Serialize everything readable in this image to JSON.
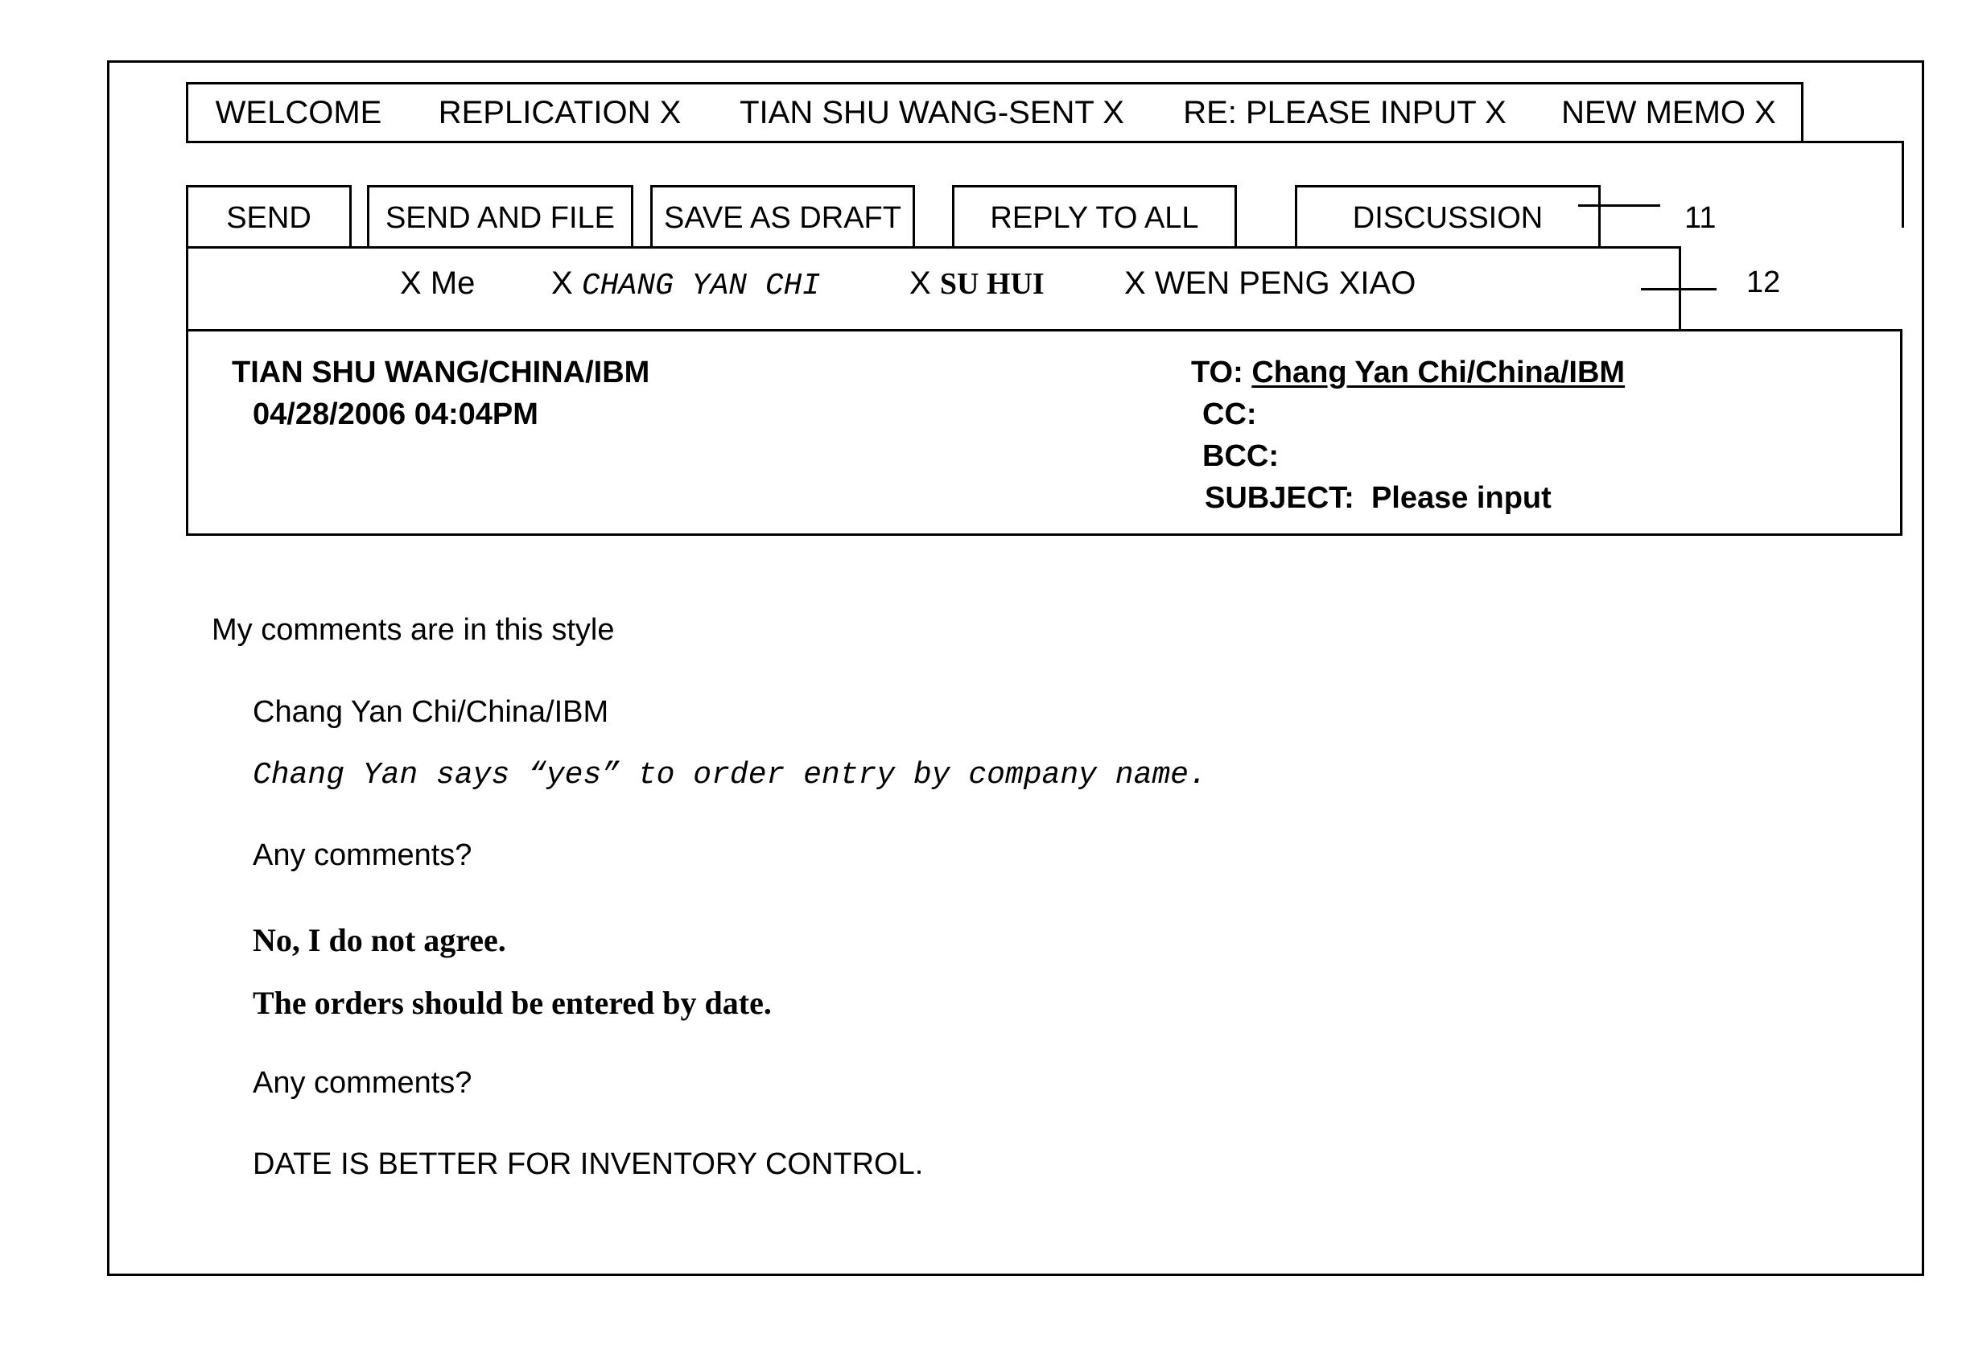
{
  "tabs": [
    {
      "label": "WELCOME"
    },
    {
      "label": "REPLICATION X"
    },
    {
      "label": "TIAN SHU WANG-SENT X"
    },
    {
      "label": "RE: PLEASE INPUT X"
    },
    {
      "label": "NEW MEMO X"
    }
  ],
  "toolbar": {
    "send": "SEND",
    "send_and_file": "SEND AND FILE",
    "save_as_draft": "SAVE AS DRAFT",
    "reply_to_all": "REPLY TO ALL",
    "discussion": "DISCUSSION"
  },
  "recipients": [
    {
      "prefix": "X",
      "name": "Me"
    },
    {
      "prefix": "X",
      "name": "CHANG YAN CHI"
    },
    {
      "prefix": "X",
      "name": "SU HUI"
    },
    {
      "prefix": "X",
      "name": "WEN PENG XIAO"
    }
  ],
  "callouts": {
    "discussion": "11",
    "recipients": "12"
  },
  "header": {
    "from": "TIAN SHU WANG/CHINA/IBM",
    "datetime": "04/28/2006 04:04PM",
    "to_label": "TO:",
    "to_value": "Chang Yan Chi/China/IBM",
    "cc_label": "CC:",
    "bcc_label": "BCC:",
    "subject_label": "SUBJECT:",
    "subject_value": "Please input"
  },
  "body": {
    "intro": "My comments are in this style",
    "author": "Chang Yan Chi/China/IBM",
    "quote": "Chang Yan says “yes” to order entry by company name.",
    "prompt1": "Any comments?",
    "reply1": "No, I do not agree.",
    "reply2": "The orders should be entered by date.",
    "prompt2": "Any comments?",
    "reply3": "DATE IS BETTER FOR INVENTORY CONTROL."
  }
}
